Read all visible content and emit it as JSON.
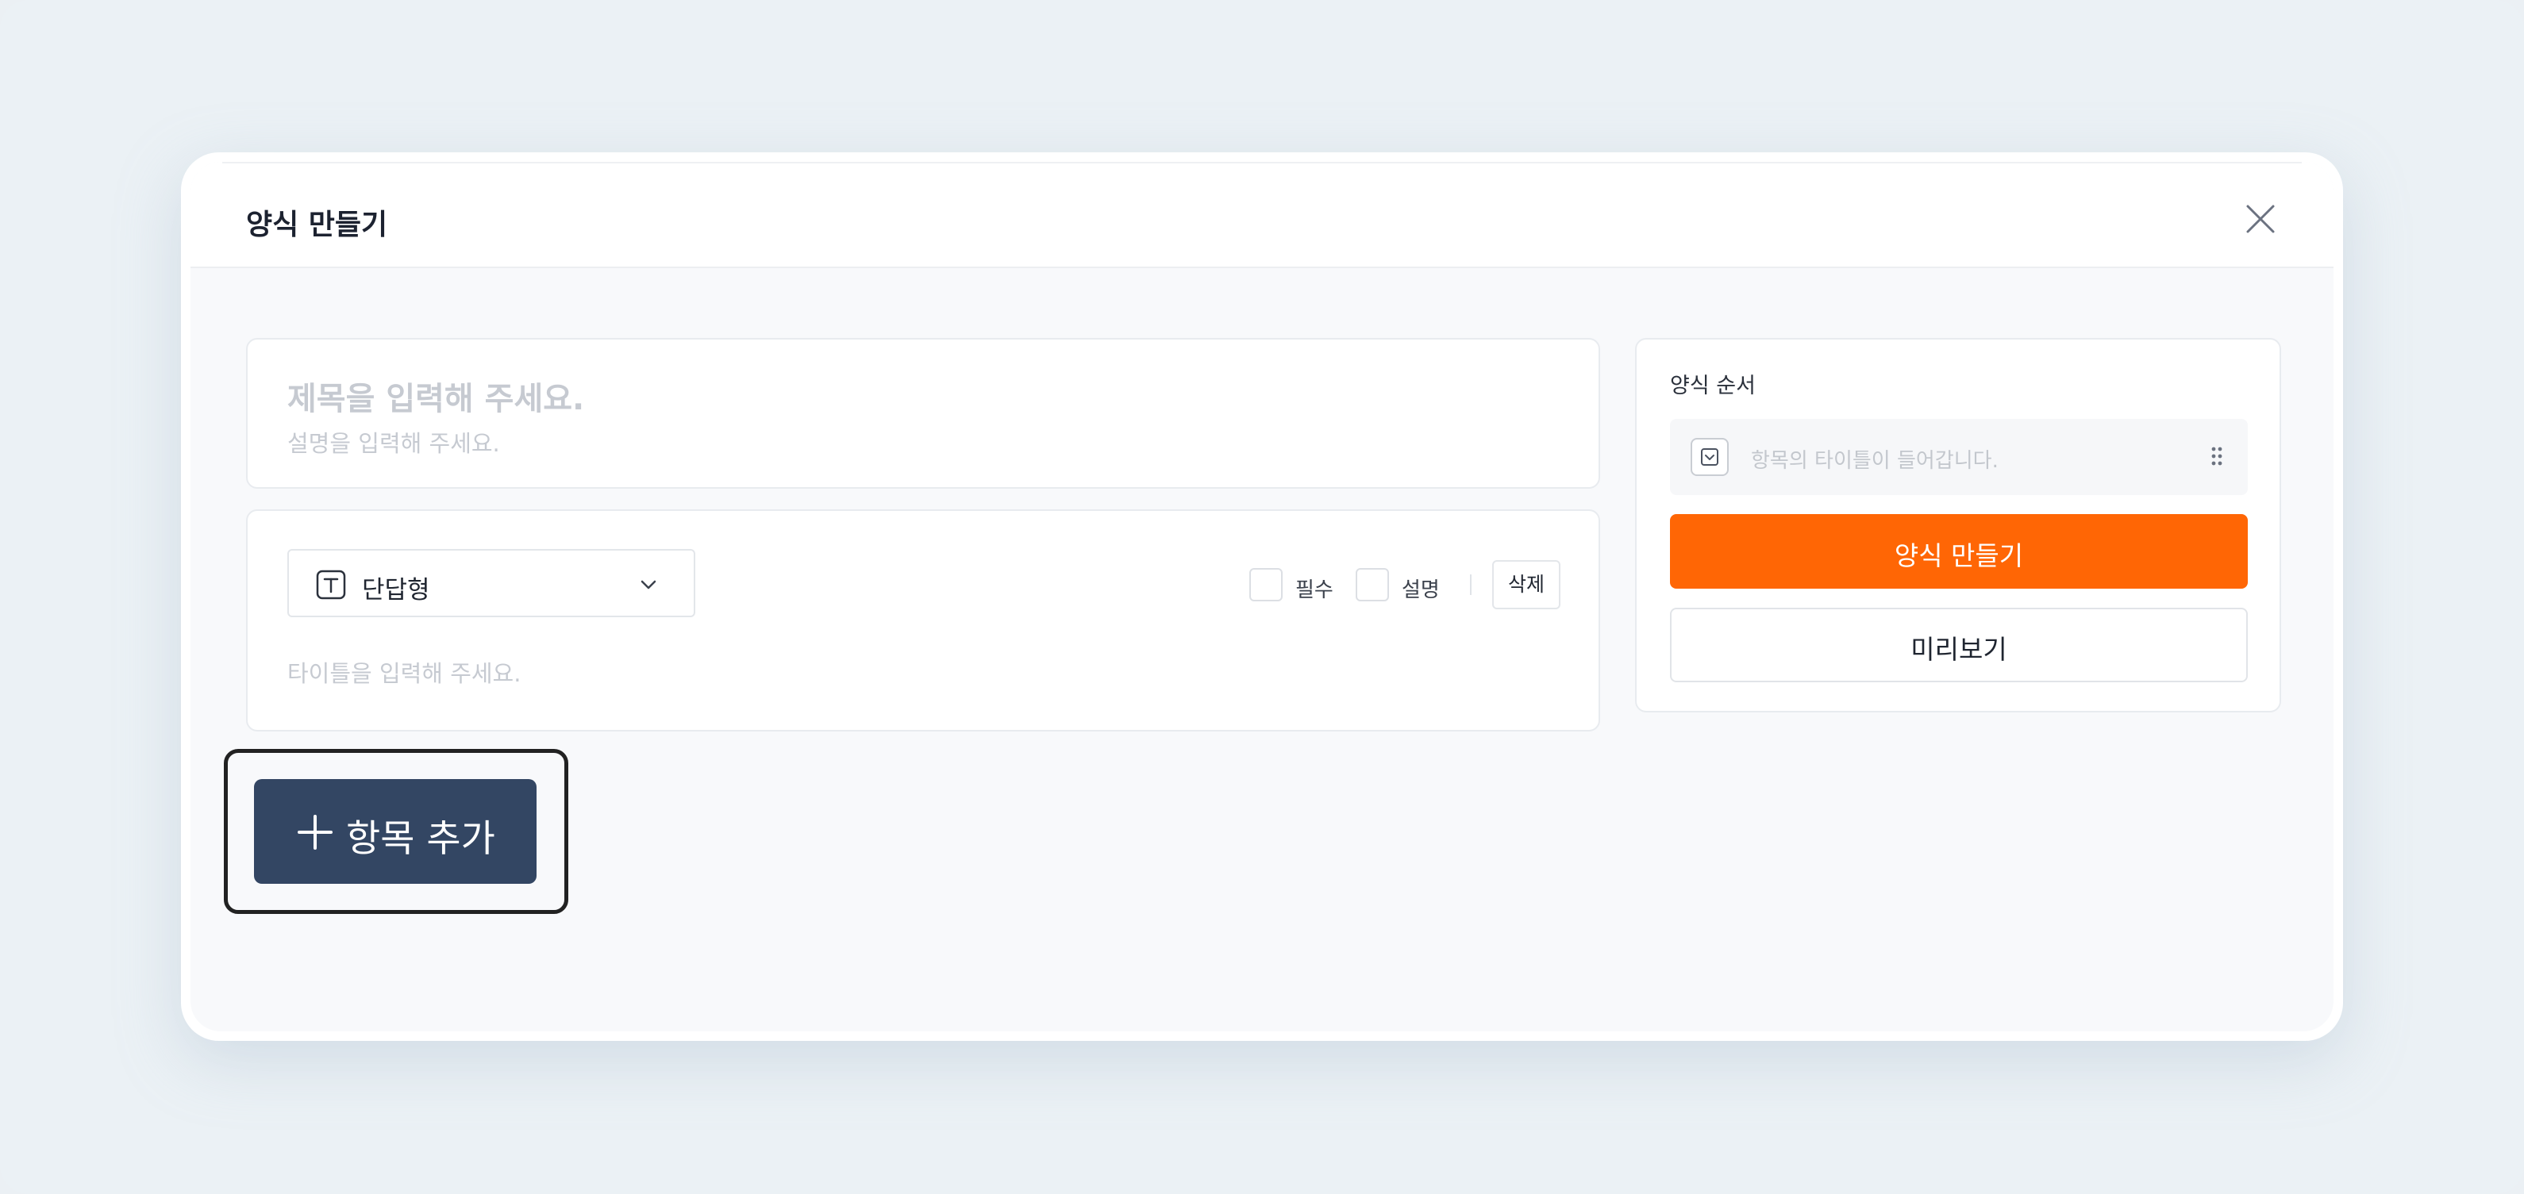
{
  "modal": {
    "title": "양식 만들기"
  },
  "form": {
    "title_placeholder": "제목을 입력해 주세요.",
    "description_placeholder": "설명을 입력해 주세요."
  },
  "item": {
    "type_label": "단답형",
    "required_label": "필수",
    "description_label": "설명",
    "delete_label": "삭제",
    "title_placeholder": "타이틀을 입력해 주세요."
  },
  "add_item": {
    "label": "항목 추가"
  },
  "order_panel": {
    "title": "양식 순서",
    "item_placeholder": "항목의 타이틀이 들어갑니다.",
    "create_label": "양식 만들기",
    "preview_label": "미리보기"
  },
  "colors": {
    "accent": "#ff6605",
    "add_button": "#334663"
  },
  "icons": {
    "close": "close-icon",
    "type": "text-type-icon",
    "chevron": "chevron-down-icon",
    "plus": "plus-icon",
    "order_item": "dropdown-type-icon",
    "drag": "drag-handle-icon"
  }
}
